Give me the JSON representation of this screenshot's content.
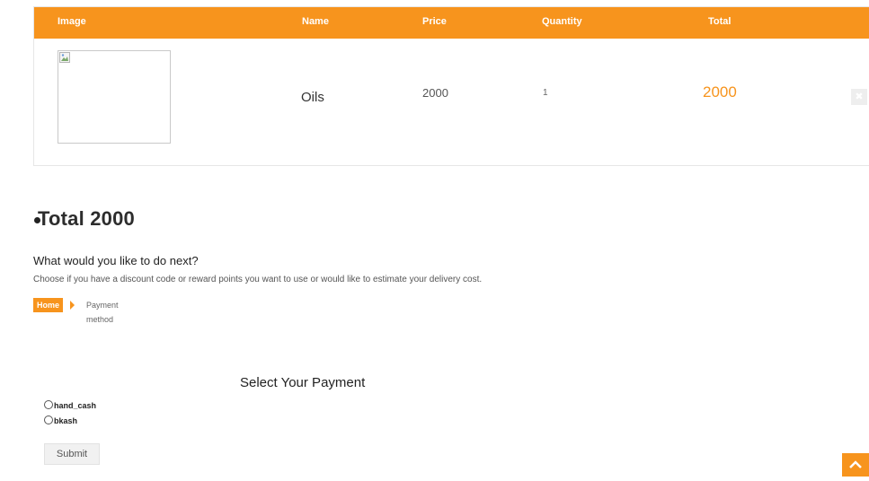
{
  "cart": {
    "headers": [
      "Image",
      "Name",
      "Price",
      "Quantity",
      "Total"
    ],
    "row": {
      "name": "Oils",
      "price": "2000",
      "quantity": "1",
      "total": "2000",
      "remove_label": "✖"
    }
  },
  "summary": {
    "total_label": "Total 2000"
  },
  "next": {
    "heading": "What would you like to do next?",
    "description": "Choose if you have a discount code or reward points you want to use or would like to estimate your delivery cost."
  },
  "breadcrumb": {
    "home": "Home",
    "current": "Payment method"
  },
  "payment": {
    "title": "Select Your Payment",
    "options": [
      "hand_cash",
      "bkash"
    ],
    "submit_label": "Submit"
  },
  "colors": {
    "accent": "#f7941d"
  },
  "icons": {
    "scroll_top": "chevron-up-icon",
    "broken_image": "broken-image-icon",
    "remove": "close-icon"
  }
}
